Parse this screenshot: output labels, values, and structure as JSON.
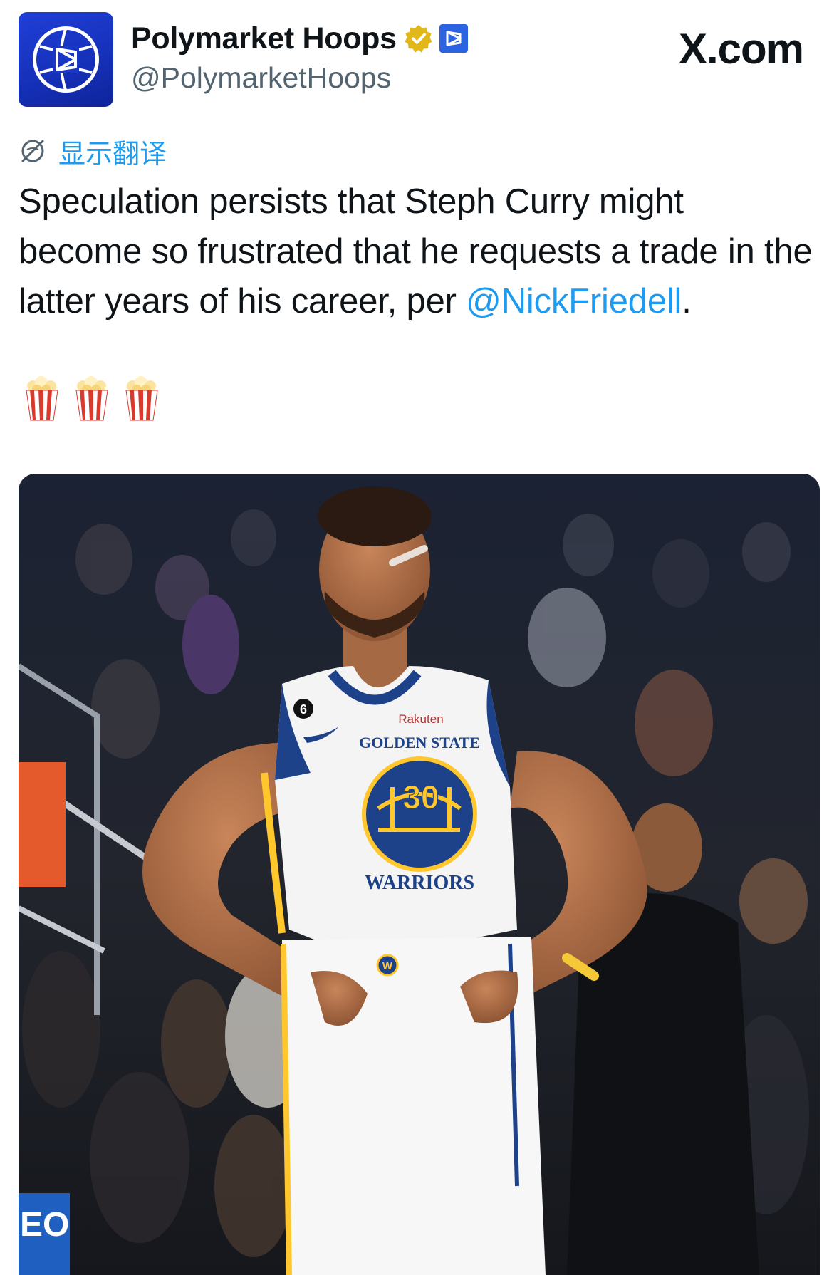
{
  "tweet": {
    "author": {
      "display_name": "Polymarket Hoops",
      "handle": "@PolymarketHoops",
      "avatar_icon": "polymarket-hoops-logo",
      "verified": true,
      "verified_badge_color": "#e2b719",
      "affiliate_badge_color": "#2b63e0"
    },
    "source_watermark": "X.com",
    "translate_label": "显示翻译",
    "text_before_mention": "Speculation persists that Steph Curry might become so frustrated that he requests a trade in the latter years of his career, per ",
    "mention": "@NickFriedell",
    "text_after_mention": ".",
    "emojis": [
      "🍿",
      "🍿",
      "🍿"
    ],
    "photo": {
      "jersey_brand": "GOLDEN STATE",
      "jersey_team": "WARRIORS",
      "jersey_number": "30",
      "jersey_sponsor": "Rakuten",
      "logo_letter": "W",
      "patch_number": "6",
      "scoreboard_text": "EO"
    }
  },
  "colors": {
    "link": "#1d9bf0",
    "text": "#0f1419",
    "secondary_text": "#536471",
    "warriors_blue": "#1d428a",
    "warriors_gold": "#ffc72c"
  }
}
